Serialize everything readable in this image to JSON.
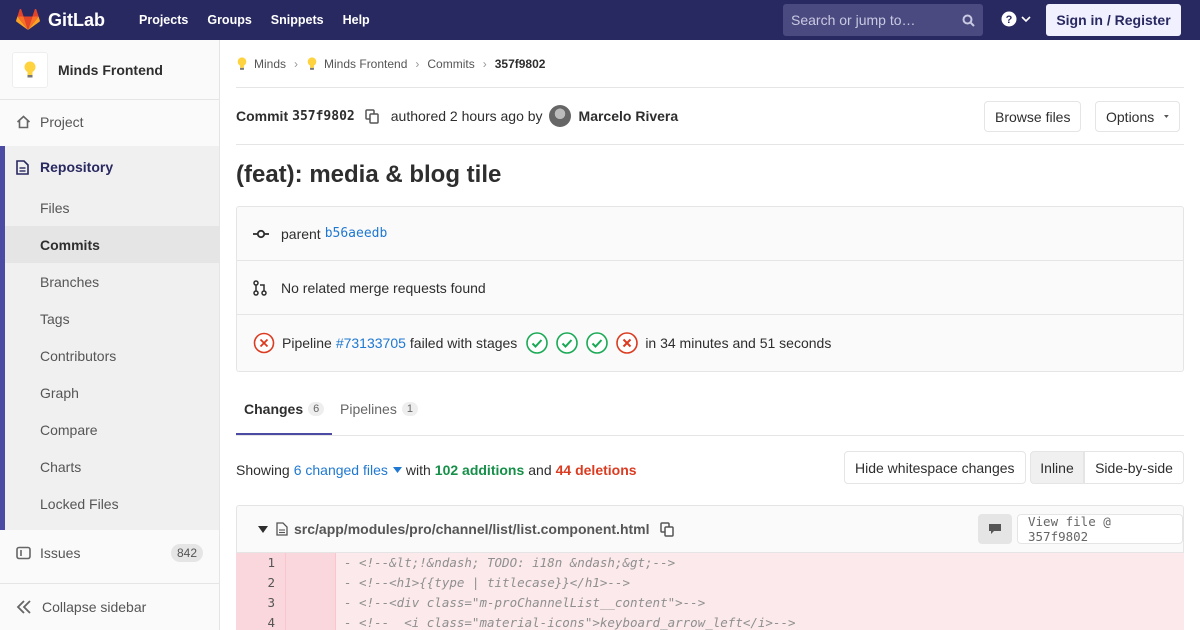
{
  "nav": {
    "brand": "GitLab",
    "links": [
      "Projects",
      "Groups",
      "Snippets",
      "Help"
    ],
    "search_placeholder": "Search or jump to…",
    "sign_in": "Sign in / Register"
  },
  "sidebar": {
    "project_name": "Minds Frontend",
    "project": "Project",
    "repository": "Repository",
    "repo_items": [
      "Files",
      "Commits",
      "Branches",
      "Tags",
      "Contributors",
      "Graph",
      "Compare",
      "Charts",
      "Locked Files"
    ],
    "active_item": "Commits",
    "issues": "Issues",
    "issues_count": "842",
    "collapse": "Collapse sidebar"
  },
  "breadcrumb": [
    "Minds",
    "Minds Frontend",
    "Commits",
    "357f9802"
  ],
  "commit": {
    "label": "Commit",
    "sha": "357f9802",
    "authored": "authored 2 hours ago by",
    "author": "Marcelo Rivera",
    "browse_files": "Browse files",
    "options": "Options",
    "title": "(feat): media & blog tile",
    "parent_label": "parent",
    "parent_sha": "b56aeedb",
    "no_mr": "No related merge requests found",
    "pipeline_label": "Pipeline",
    "pipeline_id": "#73133705",
    "pipeline_status": "failed with stages",
    "pipeline_duration": "in 34 minutes and 51 seconds",
    "stages": [
      "success",
      "success",
      "success",
      "failed"
    ]
  },
  "tabs": [
    {
      "label": "Changes",
      "count": "6"
    },
    {
      "label": "Pipelines",
      "count": "1"
    }
  ],
  "diff_summary": {
    "showing": "Showing",
    "changed_files": "6 changed files",
    "with": "with",
    "additions": "102 additions",
    "and": "and",
    "deletions": "44 deletions",
    "hide_ws": "Hide whitespace changes",
    "inline": "Inline",
    "side_by_side": "Side-by-side"
  },
  "file": {
    "path": "src/app/modules/pro/channel/list/list.component.html",
    "view_file": "View file @ 357f9802"
  },
  "code_lines": [
    {
      "num": "1",
      "text": "- <!--&lt;!&ndash; TODO: i18n &ndash;&gt;-->"
    },
    {
      "num": "2",
      "text": "- <!--<h1>{{type | titlecase}}</h1>-->"
    },
    {
      "num": "3",
      "text": "- <!--<div class=\"m-proChannelList__content\">-->"
    },
    {
      "num": "4",
      "text": "- <!--  <i class=\"material-icons\">keyboard_arrow_left</i>-->"
    }
  ],
  "colors": {
    "nav_bg": "#292961",
    "accent": "#4b4ba3",
    "link": "#1f78d1",
    "additions": "#168f48",
    "deletions": "#db3b21",
    "success": "#1aaa55",
    "failed": "#db3b21"
  }
}
